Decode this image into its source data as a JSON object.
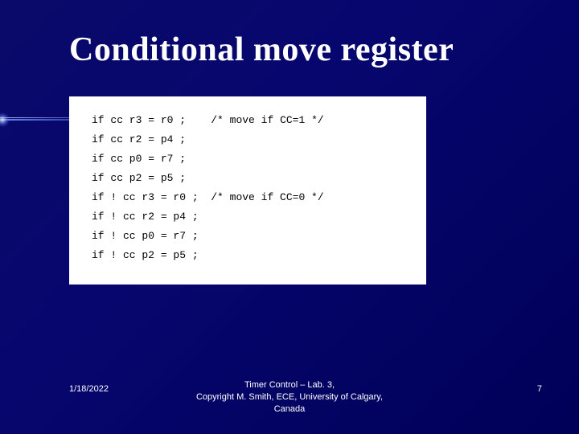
{
  "title": "Conditional move register",
  "code": {
    "lines": [
      {
        "stmt": "if cc r3 = r0 ;",
        "comment": "/* move if CC=1 */"
      },
      {
        "stmt": "if cc r2 = p4 ;",
        "comment": ""
      },
      {
        "stmt": "if cc p0 = r7 ;",
        "comment": ""
      },
      {
        "stmt": "if cc p2 = p5 ;",
        "comment": ""
      },
      {
        "stmt": "if ! cc r3 = r0 ;",
        "comment": "/* move if CC=0 */"
      },
      {
        "stmt": "if ! cc r2 = p4 ;",
        "comment": ""
      },
      {
        "stmt": "if ! cc p0 = r7 ;",
        "comment": ""
      },
      {
        "stmt": "if ! cc p2 = p5 ;",
        "comment": ""
      }
    ]
  },
  "footer": {
    "date": "1/18/2022",
    "center_line1": "Timer Control – Lab. 3,",
    "center_line2": "Copyright M. Smith, ECE, University of Calgary,",
    "center_line3": "Canada",
    "page": "7"
  }
}
